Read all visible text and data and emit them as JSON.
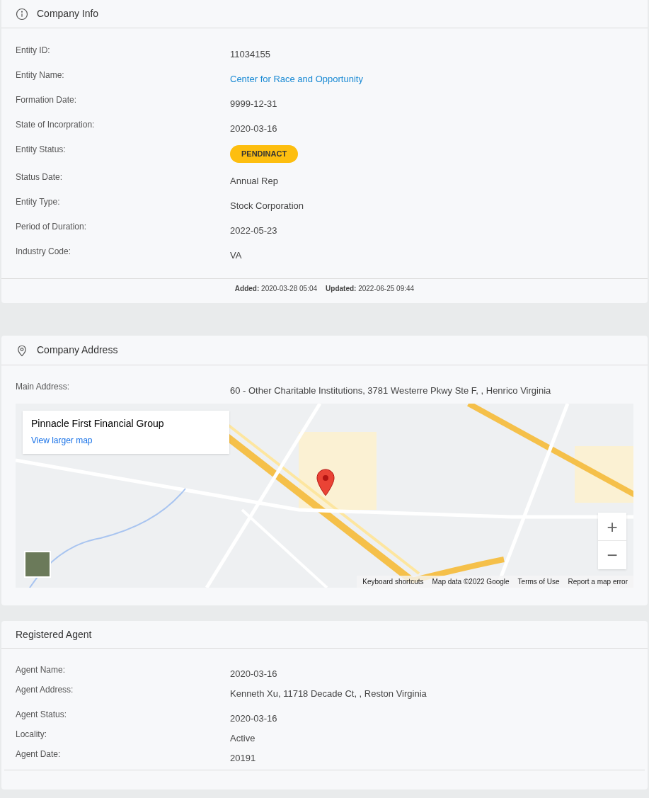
{
  "company_info": {
    "title": "Company Info",
    "fields": [
      {
        "label": "Entity ID:",
        "value": "11034155",
        "kind": "text"
      },
      {
        "label": "Entity Name:",
        "value": "Center for Race and Opportunity",
        "kind": "link"
      },
      {
        "label": "Formation Date:",
        "value": "9999-12-31",
        "kind": "text"
      },
      {
        "label": "State of Incorpration:",
        "value": "2020-03-16",
        "kind": "text"
      },
      {
        "label": "Entity Status:",
        "value": "PENDINACT",
        "kind": "badge"
      },
      {
        "label": "Status Date:",
        "value": "Annual Rep",
        "kind": "text"
      },
      {
        "label": "Entity Type:",
        "value": "Stock Corporation",
        "kind": "text"
      },
      {
        "label": "Period of Duration:",
        "value": "2022-05-23",
        "kind": "text"
      },
      {
        "label": "Industry Code:",
        "value": "VA",
        "kind": "text"
      }
    ],
    "footer": [
      {
        "label": "Added:",
        "value": "2020-03-28 05:04"
      },
      {
        "label": "Updated:",
        "value": "2022-06-25 09:44"
      }
    ]
  },
  "company_address": {
    "title": "Company Address",
    "fields": [
      {
        "label": "Main Address:",
        "value": "60 - Other Charitable Institutions, 3781 Westerre Pkwy Ste F, , Henrico Virginia",
        "kind": "text"
      }
    ],
    "map": {
      "place_title": "Pinnacle First Financial Group",
      "place_link": "View larger map",
      "zoom_in": "+",
      "zoom_out": "−",
      "attribution": [
        "Keyboard shortcuts",
        "Map data ©2022 Google",
        "Terms of Use",
        "Report a map error"
      ]
    }
  },
  "registered_agent": {
    "title": "Registered Agent",
    "fields": [
      {
        "label": "Agent Name:",
        "value": "2020-03-16",
        "kind": "text"
      },
      {
        "label": "Agent Address:",
        "value": "Kenneth Xu, 11718 Decade Ct, , Reston Virginia",
        "kind": "text"
      },
      {
        "label": "Agent Status:",
        "value": "2020-03-16",
        "kind": "text"
      },
      {
        "label": "Locality:",
        "value": "Active",
        "kind": "text"
      },
      {
        "label": "Agent Date:",
        "value": "20191",
        "kind": "text"
      }
    ]
  }
}
